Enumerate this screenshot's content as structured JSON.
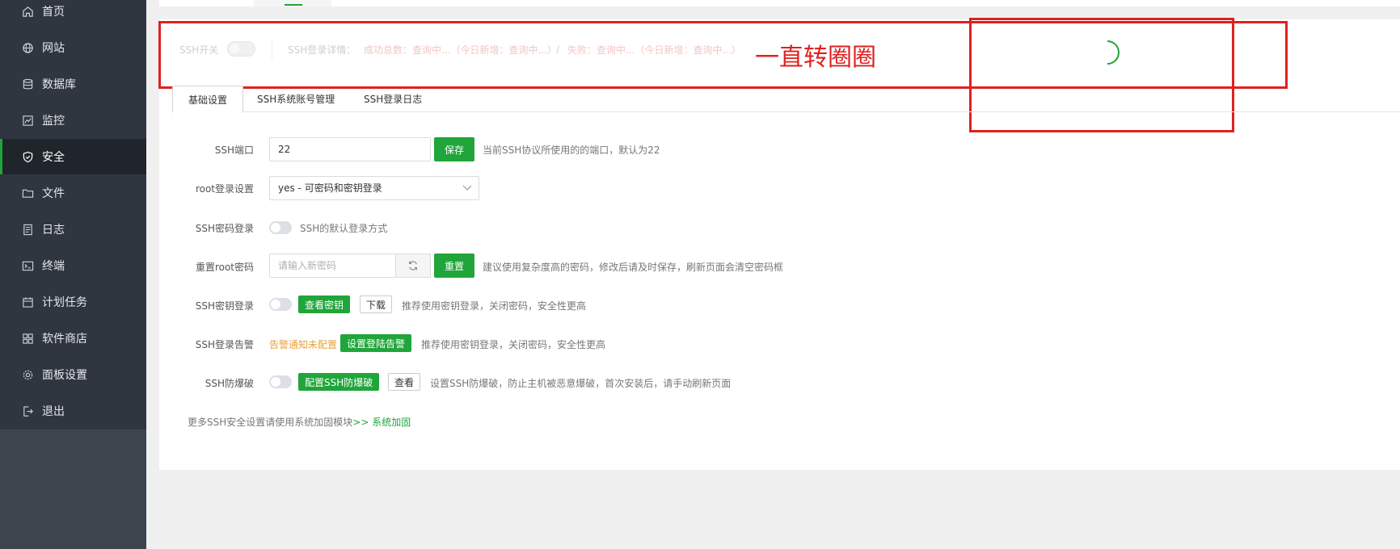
{
  "sidebar": {
    "items": [
      {
        "label": "首页",
        "icon": "home-icon"
      },
      {
        "label": "网站",
        "icon": "globe-icon"
      },
      {
        "label": "数据库",
        "icon": "database-icon"
      },
      {
        "label": "监控",
        "icon": "monitor-icon"
      },
      {
        "label": "安全",
        "icon": "shield-icon",
        "active": true
      },
      {
        "label": "文件",
        "icon": "folder-icon"
      },
      {
        "label": "日志",
        "icon": "log-icon"
      },
      {
        "label": "终端",
        "icon": "terminal-icon"
      },
      {
        "label": "计划任务",
        "icon": "calendar-icon"
      },
      {
        "label": "软件商店",
        "icon": "apps-icon"
      },
      {
        "label": "面板设置",
        "icon": "gear-icon"
      },
      {
        "label": "退出",
        "icon": "logout-icon"
      }
    ]
  },
  "status": {
    "ssh_switch_label": "SSH开关",
    "login_detail_label": "SSH登录详情：",
    "success_text": "成功总数：查询中...（今日新增：查询中...）",
    "separator": "/",
    "fail_text": "失败：查询中...（今日新增：查询中...）"
  },
  "annotation": {
    "text": "一直转圈圈"
  },
  "tabs": [
    "基础设置",
    "SSH系统账号管理",
    "SSH登录日志"
  ],
  "form": {
    "port": {
      "label": "SSH端口",
      "value": "22",
      "button": "保存",
      "hint": "当前SSH协议所使用的的端口，默认为22"
    },
    "root_login": {
      "label": "root登录设置",
      "selected": "yes - 可密码和密钥登录"
    },
    "password_login": {
      "label": "SSH密码登录",
      "hint": "SSH的默认登录方式"
    },
    "reset_root": {
      "label": "重置root密码",
      "placeholder": "请输入新密码",
      "button": "重置",
      "hint": "建议使用复杂度高的密码，修改后请及时保存，刷新页面会清空密码框"
    },
    "key_login": {
      "label": "SSH密钥登录",
      "view_button": "查看密钥",
      "download_button": "下载",
      "hint": "推荐使用密钥登录，关闭密码，安全性更高"
    },
    "alarm": {
      "label": "SSH登录告警",
      "status": "告警通知未配置",
      "button": "设置登陆告警",
      "hint": "推荐使用密钥登录，关闭密码，安全性更高"
    },
    "anti_brute": {
      "label": "SSH防爆破",
      "config_button": "配置SSH防爆破",
      "view_button": "查看",
      "hint": "设置SSH防爆破，防止主机被恶意爆破，首次安装后，请手动刷新页面"
    }
  },
  "footer": {
    "text": "更多SSH安全设置请使用系统加固模块",
    "link": ">> 系统加固"
  },
  "colors": {
    "accent": "#20a53a",
    "annotation": "#e02020",
    "sidebar": "#2f3640"
  }
}
